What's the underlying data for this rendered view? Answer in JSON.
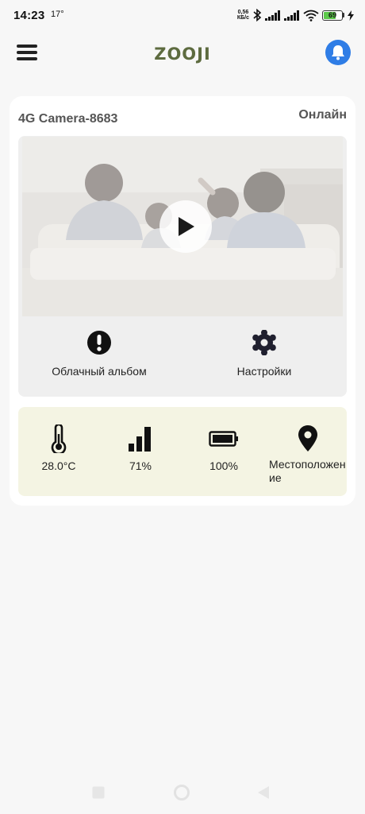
{
  "status_bar": {
    "time": "14:23",
    "temperature": "17°",
    "net_speed_value": "0,56",
    "net_speed_unit": "КБ/с",
    "battery_level": "69",
    "battery_fraction": 0.69
  },
  "header": {
    "logo": "ZOOJI",
    "accent_color": "#2f7de6",
    "logo_color": "#5d6b3f"
  },
  "camera": {
    "name": "4G Camera-8683",
    "status": "Онлайн",
    "actions": [
      {
        "label": "Облачный альбом",
        "icon": "alert-circle-icon"
      },
      {
        "label": "Настройки",
        "icon": "gear-icon"
      }
    ]
  },
  "stats": [
    {
      "value": "28.0°C",
      "icon": "thermometer-icon"
    },
    {
      "value": "71%",
      "icon": "signal-bars-icon"
    },
    {
      "value": "100%",
      "icon": "battery-icon"
    },
    {
      "value": "Местоположен\nие",
      "icon": "location-pin-icon"
    }
  ],
  "nav": [
    "recent-apps-button",
    "home-button",
    "back-button"
  ]
}
